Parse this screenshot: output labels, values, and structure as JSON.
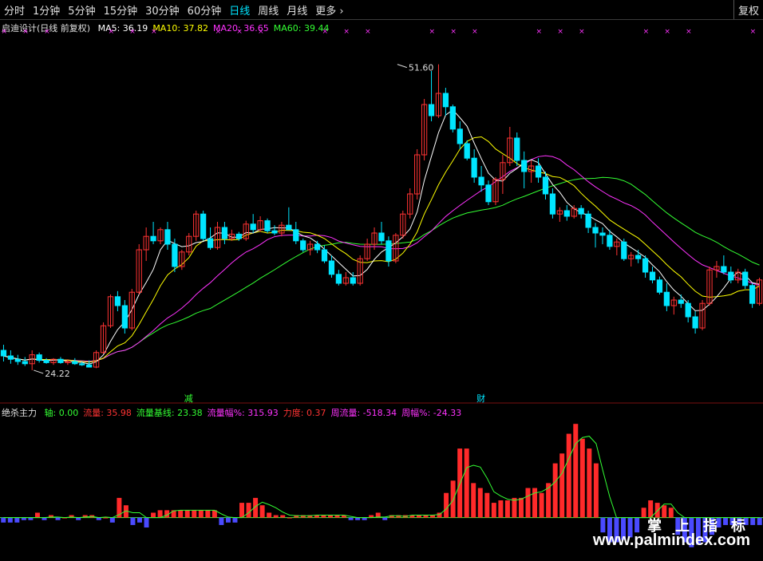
{
  "toolbar": {
    "tabs": [
      {
        "label": "分时",
        "active": false
      },
      {
        "label": "1分钟",
        "active": false
      },
      {
        "label": "5分钟",
        "active": false
      },
      {
        "label": "15分钟",
        "active": false
      },
      {
        "label": "30分钟",
        "active": false
      },
      {
        "label": "60分钟",
        "active": false
      },
      {
        "label": "日线",
        "active": true
      },
      {
        "label": "周线",
        "active": false
      },
      {
        "label": "月线",
        "active": false
      }
    ],
    "more_label": "更多",
    "fq_label": "复权"
  },
  "main_legend": {
    "title": "启迪设计(日线 前复权)",
    "items": [
      {
        "text": "MA5: 36.19",
        "color": "#ffffff"
      },
      {
        "text": "MA10: 37.82",
        "color": "#ffff00"
      },
      {
        "text": "MA20: 36.65",
        "color": "#ff33ff"
      },
      {
        "text": "MA60: 39.44",
        "color": "#33ff33"
      }
    ]
  },
  "sub_legend": {
    "title": "绝杀主力",
    "items": [
      {
        "text": "轴: 0.00",
        "color": "#33ff33"
      },
      {
        "text": "流量: 35.98",
        "color": "#ff3333"
      },
      {
        "text": "流量基线: 23.38",
        "color": "#33ff33"
      },
      {
        "text": "流量幅%: 315.93",
        "color": "#ff33ff"
      },
      {
        "text": "力度: 0.37",
        "color": "#ff3333"
      },
      {
        "text": "周流量: -518.34",
        "color": "#ff33ff"
      },
      {
        "text": "周幅%: -24.33",
        "color": "#ff33ff"
      }
    ]
  },
  "watermark": {
    "line1": "掌 上 指 标",
    "line2": "www.palmindex.com"
  },
  "chart_data": [
    {
      "type": "candlestick",
      "ylim": [
        22,
        54
      ],
      "colors": {
        "up": "#ff3333",
        "down": "#00e5ff",
        "ma5": "#ffffff",
        "ma10": "#ffff00",
        "ma20": "#ff33ff",
        "ma60": "#33ff33"
      },
      "annotations": [
        {
          "text": "51.60",
          "index": 55,
          "price": 51.6
        },
        {
          "text": "24.22",
          "index": 4,
          "price": 24.22
        }
      ],
      "markers": [
        {
          "text": "减",
          "index": 26,
          "color": "#33ff33"
        },
        {
          "text": "财",
          "index": 67,
          "color": "#00e5ff"
        }
      ],
      "ohlc": [
        [
          26.0,
          26.5,
          25.0,
          25.5
        ],
        [
          25.5,
          26.0,
          24.8,
          25.2
        ],
        [
          25.2,
          25.6,
          24.7,
          25.0
        ],
        [
          25.0,
          25.4,
          24.6,
          24.8
        ],
        [
          24.8,
          26.0,
          24.22,
          25.6
        ],
        [
          25.6,
          25.8,
          24.9,
          25.1
        ],
        [
          25.1,
          25.3,
          24.8,
          24.9
        ],
        [
          24.9,
          25.3,
          24.7,
          25.2
        ],
        [
          25.2,
          25.4,
          24.8,
          24.9
        ],
        [
          24.9,
          25.2,
          24.7,
          25.0
        ],
        [
          25.0,
          25.3,
          24.7,
          24.8
        ],
        [
          24.8,
          25.0,
          24.6,
          24.7
        ],
        [
          24.7,
          25.1,
          24.5,
          24.5
        ],
        [
          24.5,
          26.0,
          24.4,
          25.8
        ],
        [
          25.8,
          28.5,
          25.7,
          28.2
        ],
        [
          28.2,
          31.0,
          28.0,
          30.8
        ],
        [
          30.8,
          31.3,
          29.5,
          30.0
        ],
        [
          30.0,
          30.5,
          27.5,
          28.0
        ],
        [
          28.0,
          31.5,
          27.8,
          31.2
        ],
        [
          31.2,
          35.5,
          31.0,
          35.0
        ],
        [
          35.0,
          37.0,
          34.0,
          36.2
        ],
        [
          36.2,
          37.5,
          35.5,
          35.8
        ],
        [
          35.8,
          37.0,
          35.5,
          36.8
        ],
        [
          36.8,
          37.5,
          35.0,
          35.5
        ],
        [
          35.5,
          36.0,
          33.0,
          33.5
        ],
        [
          33.5,
          35.0,
          33.2,
          34.8
        ],
        [
          34.8,
          36.5,
          34.5,
          36.2
        ],
        [
          36.2,
          38.5,
          35.8,
          38.2
        ],
        [
          38.2,
          38.5,
          35.8,
          36.0
        ],
        [
          36.0,
          37.0,
          35.0,
          35.2
        ],
        [
          35.2,
          37.5,
          35.0,
          37.0
        ],
        [
          37.0,
          37.5,
          35.5,
          36.0
        ],
        [
          36.0,
          36.8,
          35.8,
          36.4
        ],
        [
          36.4,
          36.6,
          35.8,
          36.0
        ],
        [
          36.0,
          37.6,
          35.8,
          37.3
        ],
        [
          37.3,
          38.2,
          36.5,
          36.8
        ],
        [
          36.8,
          38.0,
          36.6,
          37.6
        ],
        [
          37.6,
          37.8,
          36.5,
          36.7
        ],
        [
          36.7,
          37.2,
          36.3,
          36.5
        ],
        [
          36.5,
          37.5,
          36.2,
          37.2
        ],
        [
          37.2,
          38.8,
          37.0,
          36.8
        ],
        [
          36.8,
          37.5,
          35.5,
          35.8
        ],
        [
          35.8,
          36.0,
          34.8,
          35.0
        ],
        [
          35.0,
          35.8,
          34.5,
          35.5
        ],
        [
          35.5,
          35.8,
          34.7,
          35.0
        ],
        [
          35.0,
          35.4,
          33.8,
          34.0
        ],
        [
          34.0,
          34.5,
          32.5,
          32.8
        ],
        [
          32.8,
          33.2,
          31.8,
          32.0
        ],
        [
          32.0,
          33.0,
          31.8,
          32.5
        ],
        [
          32.5,
          33.0,
          31.8,
          32.0
        ],
        [
          32.0,
          34.5,
          31.8,
          34.2
        ],
        [
          34.2,
          36.0,
          34.0,
          35.5
        ],
        [
          35.5,
          37.0,
          35.0,
          36.5
        ],
        [
          36.5,
          37.5,
          35.5,
          35.8
        ],
        [
          35.8,
          36.2,
          33.5,
          34.0
        ],
        [
          34.0,
          36.5,
          33.8,
          36.3
        ],
        [
          36.3,
          38.5,
          36.0,
          38.2
        ],
        [
          38.2,
          40.5,
          37.8,
          40.0
        ],
        [
          40.0,
          44.0,
          39.5,
          43.5
        ],
        [
          43.5,
          48.5,
          43.0,
          48.0
        ],
        [
          48.0,
          51.0,
          46.5,
          47.0
        ],
        [
          47.0,
          51.6,
          46.8,
          49.0
        ],
        [
          49.0,
          49.5,
          47.0,
          47.8
        ],
        [
          47.8,
          48.0,
          45.5,
          45.8
        ],
        [
          45.8,
          46.5,
          44.0,
          44.5
        ],
        [
          44.5,
          44.8,
          43.0,
          43.2
        ],
        [
          43.2,
          44.0,
          41.0,
          41.5
        ],
        [
          41.5,
          42.5,
          40.2,
          40.8
        ],
        [
          40.8,
          41.2,
          39.0,
          39.3
        ],
        [
          39.3,
          41.5,
          39.0,
          41.3
        ],
        [
          41.3,
          43.5,
          40.0,
          42.8
        ],
        [
          42.8,
          46.0,
          42.5,
          45.0
        ],
        [
          45.0,
          45.5,
          42.5,
          43.0
        ],
        [
          43.0,
          43.8,
          40.5,
          42.0
        ],
        [
          42.0,
          43.0,
          41.0,
          42.5
        ],
        [
          42.5,
          43.2,
          41.0,
          41.5
        ],
        [
          41.5,
          42.0,
          39.5,
          40.0
        ],
        [
          40.0,
          40.5,
          37.8,
          38.2
        ],
        [
          38.2,
          38.8,
          37.5,
          38.5
        ],
        [
          38.5,
          39.0,
          37.6,
          38.0
        ],
        [
          38.0,
          39.0,
          37.8,
          38.7
        ],
        [
          38.7,
          39.0,
          37.8,
          38.2
        ],
        [
          38.2,
          38.5,
          36.5,
          37.0
        ],
        [
          37.0,
          37.4,
          35.2,
          36.5
        ],
        [
          36.5,
          37.0,
          35.5,
          36.3
        ],
        [
          36.3,
          36.8,
          35.0,
          35.3
        ],
        [
          35.3,
          36.0,
          34.5,
          35.7
        ],
        [
          35.7,
          36.0,
          34.0,
          34.2
        ],
        [
          34.2,
          34.8,
          33.5,
          34.5
        ],
        [
          34.5,
          35.0,
          33.8,
          34.2
        ],
        [
          34.2,
          34.5,
          32.5,
          33.0
        ],
        [
          33.0,
          33.5,
          32.0,
          32.3
        ],
        [
          32.3,
          32.6,
          31.0,
          31.2
        ],
        [
          31.2,
          32.0,
          29.5,
          30.0
        ],
        [
          30.0,
          30.8,
          29.2,
          30.5
        ],
        [
          30.5,
          31.0,
          29.8,
          30.2
        ],
        [
          30.2,
          30.5,
          28.5,
          29.0
        ],
        [
          29.0,
          29.5,
          27.5,
          28.0
        ],
        [
          28.0,
          30.5,
          27.8,
          30.2
        ],
        [
          30.2,
          33.5,
          30.0,
          33.2
        ],
        [
          33.2,
          34.0,
          32.5,
          33.5
        ],
        [
          33.5,
          34.5,
          32.8,
          33.0
        ],
        [
          33.0,
          33.5,
          32.0,
          32.3
        ],
        [
          32.3,
          33.3,
          32.0,
          33.0
        ],
        [
          33.0,
          33.3,
          31.5,
          31.8
        ],
        [
          31.8,
          32.0,
          29.8,
          30.2
        ],
        [
          30.2,
          32.5,
          30.0,
          32.3
        ]
      ]
    },
    {
      "type": "bar",
      "title": "绝杀主力",
      "values": [
        -2,
        -2,
        -2,
        -1,
        -1,
        2,
        -1,
        1,
        -1,
        0,
        1,
        -1,
        1,
        1,
        -1,
        0,
        -2,
        8,
        5,
        -3,
        -2,
        -4,
        2,
        3,
        3,
        3,
        3,
        3,
        3,
        3,
        3,
        3,
        -3,
        -2,
        -2,
        6,
        6,
        8,
        5,
        2,
        1,
        1,
        0,
        1,
        1,
        1,
        1,
        1,
        1,
        1,
        1,
        -1,
        -1,
        -1,
        1,
        2,
        -1,
        1,
        1,
        1,
        1,
        1,
        1,
        1,
        2,
        10,
        15,
        28,
        28,
        14,
        12,
        10,
        6,
        7,
        7,
        8,
        8,
        12,
        12,
        10,
        14,
        22,
        26,
        34,
        38,
        32,
        28,
        22,
        -6,
        -10,
        -10,
        -9,
        -8,
        -6,
        4,
        7,
        6,
        5,
        4,
        -7,
        -10,
        -12,
        -11,
        -10,
        -7,
        -4,
        -3,
        -3,
        -3,
        -3,
        -3,
        -3
      ],
      "ylim": [
        -15,
        40
      ]
    }
  ]
}
